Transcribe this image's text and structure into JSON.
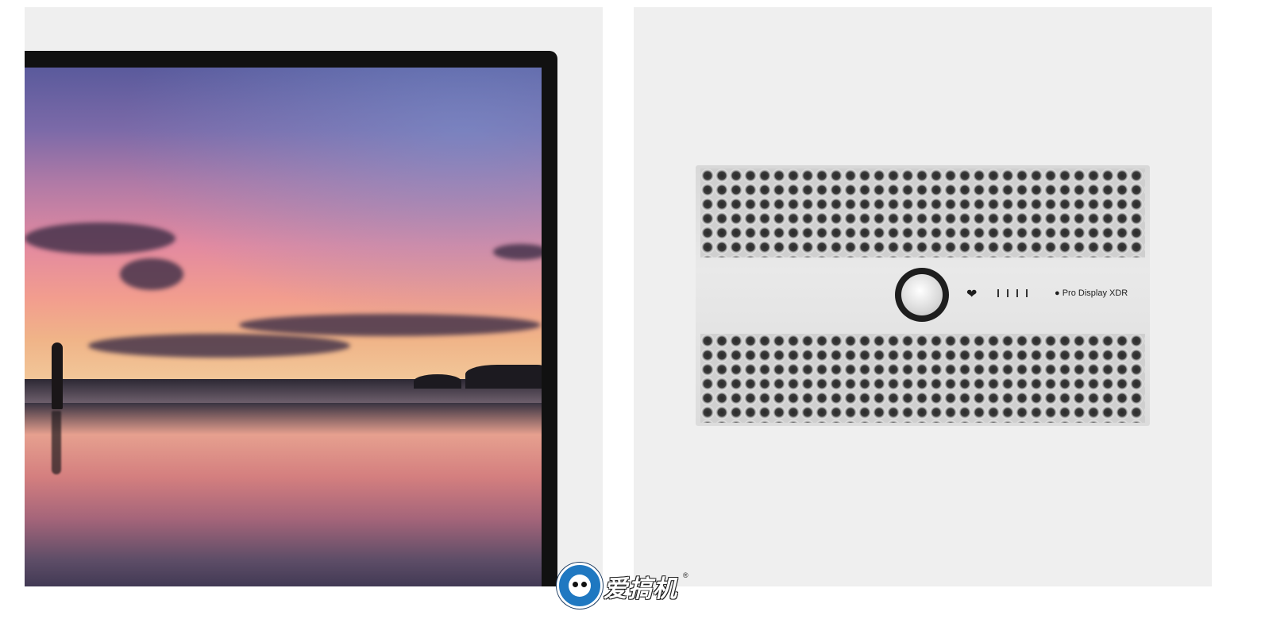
{
  "left_panel": {
    "subject": "display-front",
    "bezel_color": "#111111",
    "screen_scene": "sunset-beach-photo"
  },
  "right_panel": {
    "subject": "display-back",
    "badge_text": "Pro Display XDR",
    "port_count": 4,
    "background": "#efefef"
  },
  "watermark": {
    "text": "爱搞机",
    "registered_mark": "®",
    "accent_color": "#1f78c1"
  }
}
